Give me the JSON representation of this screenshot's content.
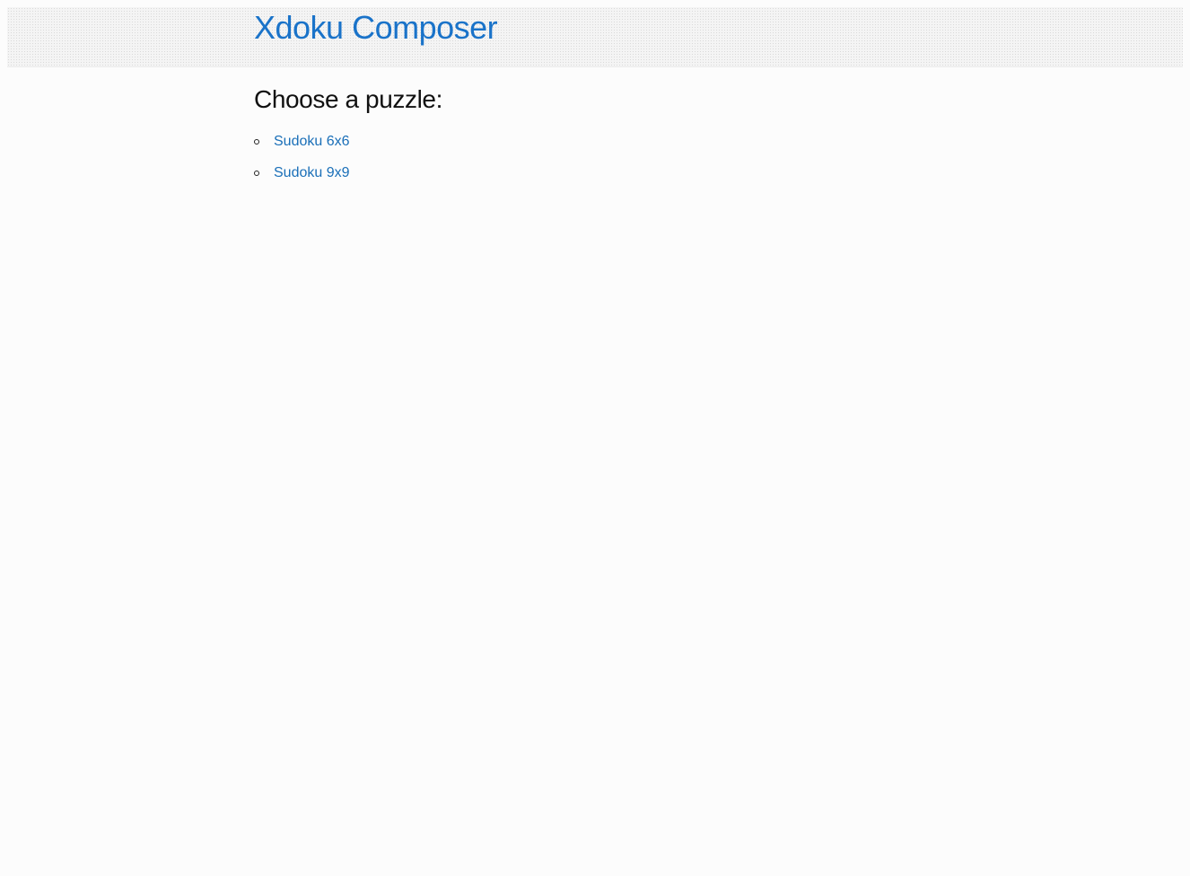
{
  "header": {
    "title": "Xdoku Composer"
  },
  "main": {
    "heading": "Choose a puzzle:",
    "puzzles": [
      {
        "label": "Sudoku 6x6"
      },
      {
        "label": "Sudoku 9x9"
      }
    ]
  },
  "colors": {
    "link": "#1a6fb8",
    "title": "#1a73c9",
    "background": "#fcfcfc"
  },
  "icons": {
    "list_bullet": "circle-bullet-icon"
  }
}
